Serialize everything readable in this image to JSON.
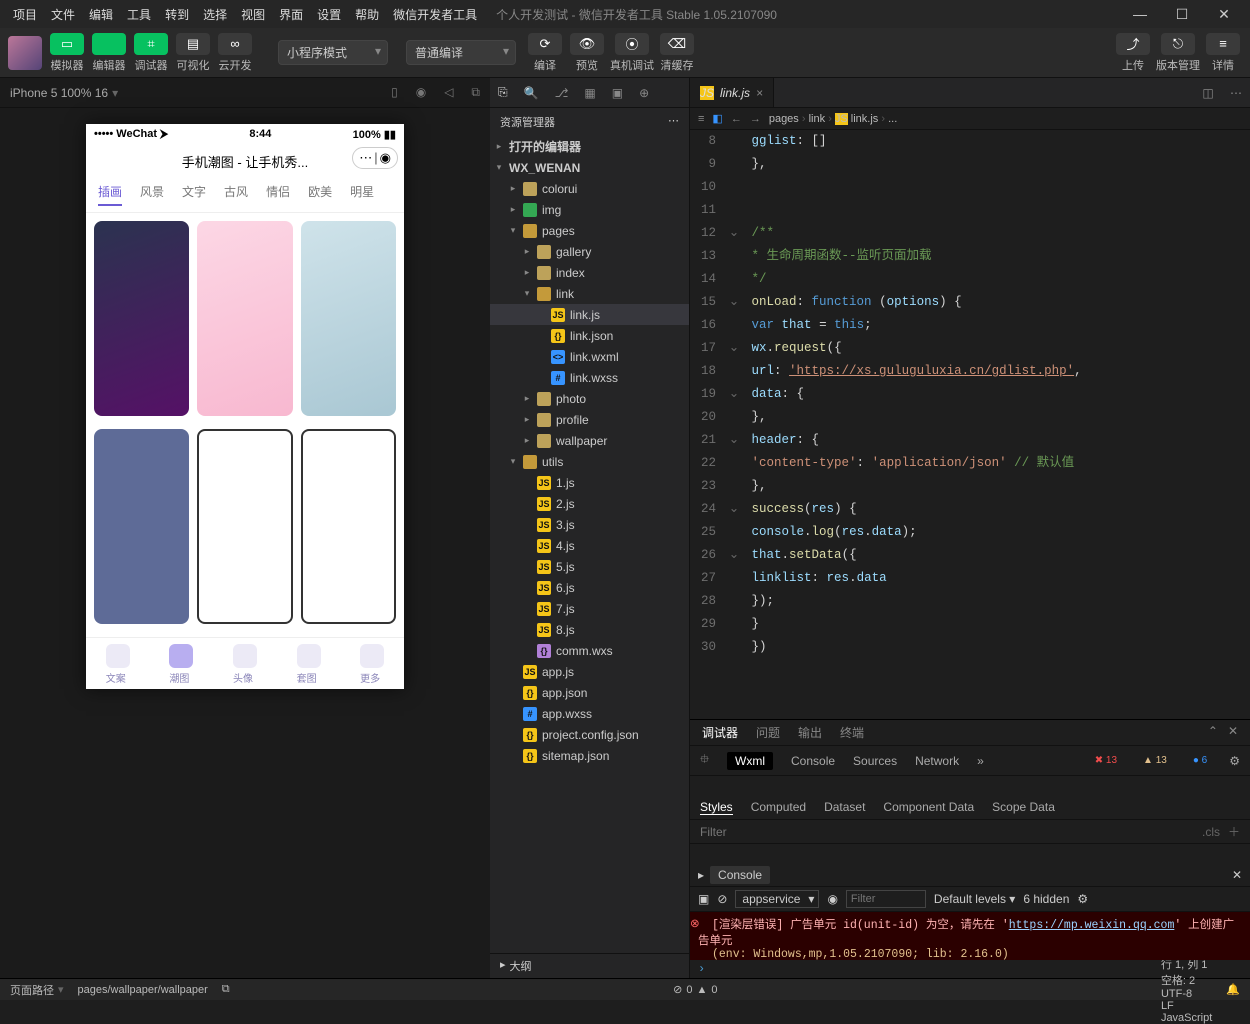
{
  "menu": {
    "items": [
      "项目",
      "文件",
      "编辑",
      "工具",
      "转到",
      "选择",
      "视图",
      "界面",
      "设置",
      "帮助",
      "微信开发者工具"
    ],
    "title": "个人开发测试 - 微信开发者工具 Stable 1.05.2107090"
  },
  "toolbar": {
    "modeButtons": [
      {
        "icon": "▭",
        "label": "模拟器",
        "cls": "green"
      },
      {
        "icon": "</>",
        "label": "编辑器",
        "cls": "green"
      },
      {
        "icon": "⌗",
        "label": "调试器",
        "cls": "green"
      },
      {
        "icon": "▤",
        "label": "可视化",
        "cls": "grey"
      },
      {
        "icon": "∞",
        "label": "云开发",
        "cls": "grey"
      }
    ],
    "compileMode": "小程序模式",
    "compileType": "普通编译",
    "centerButtons": [
      {
        "icon": "⟳",
        "label": "编译"
      },
      {
        "icon": "👁",
        "label": "预览"
      },
      {
        "icon": "⦿",
        "label": "真机调试"
      },
      {
        "icon": "⌫",
        "label": "清缓存"
      }
    ],
    "rightButtons": [
      {
        "icon": "⤴",
        "label": "上传"
      },
      {
        "icon": "⎋",
        "label": "版本管理"
      },
      {
        "icon": "≡",
        "label": "详情"
      }
    ]
  },
  "simulator": {
    "device": "iPhone 5 100% 16",
    "status": {
      "left": "••••• WeChat ⮞",
      "time": "8:44",
      "right": "100%"
    },
    "appTitle": "手机潮图 - 让手机秀...",
    "tabs": [
      "插画",
      "风景",
      "文字",
      "古风",
      "情侣",
      "欧美",
      "明星"
    ],
    "tabbar": [
      {
        "l": "文案"
      },
      {
        "l": "潮图"
      },
      {
        "l": "头像"
      },
      {
        "l": "套图"
      },
      {
        "l": "更多"
      }
    ],
    "activeTabbar": 1
  },
  "explorer": {
    "title": "资源管理器",
    "sections": [
      {
        "label": "打开的编辑器",
        "open": false
      },
      {
        "label": "WX_WENAN",
        "open": true
      }
    ],
    "tree": [
      {
        "d": 1,
        "t": "folder",
        "open": false,
        "n": "colorui"
      },
      {
        "d": 1,
        "t": "app",
        "open": false,
        "n": "img"
      },
      {
        "d": 1,
        "t": "folder-open",
        "open": true,
        "n": "pages"
      },
      {
        "d": 2,
        "t": "folder",
        "open": false,
        "n": "gallery"
      },
      {
        "d": 2,
        "t": "folder",
        "open": false,
        "n": "index"
      },
      {
        "d": 2,
        "t": "folder-open",
        "open": true,
        "n": "link"
      },
      {
        "d": 3,
        "t": "js",
        "n": "link.js",
        "sel": true
      },
      {
        "d": 3,
        "t": "json",
        "n": "link.json"
      },
      {
        "d": 3,
        "t": "wxml",
        "n": "link.wxml"
      },
      {
        "d": 3,
        "t": "wxss",
        "n": "link.wxss"
      },
      {
        "d": 2,
        "t": "folder",
        "open": false,
        "n": "photo"
      },
      {
        "d": 2,
        "t": "folder",
        "open": false,
        "n": "profile"
      },
      {
        "d": 2,
        "t": "folder",
        "open": false,
        "n": "wallpaper"
      },
      {
        "d": 1,
        "t": "folder-open",
        "open": true,
        "n": "utils"
      },
      {
        "d": 2,
        "t": "js",
        "n": "1.js"
      },
      {
        "d": 2,
        "t": "js",
        "n": "2.js"
      },
      {
        "d": 2,
        "t": "js",
        "n": "3.js"
      },
      {
        "d": 2,
        "t": "js",
        "n": "4.js"
      },
      {
        "d": 2,
        "t": "js",
        "n": "5.js"
      },
      {
        "d": 2,
        "t": "js",
        "n": "6.js"
      },
      {
        "d": 2,
        "t": "js",
        "n": "7.js"
      },
      {
        "d": 2,
        "t": "js",
        "n": "8.js"
      },
      {
        "d": 2,
        "t": "wxs",
        "n": "comm.wxs"
      },
      {
        "d": 1,
        "t": "js",
        "n": "app.js"
      },
      {
        "d": 1,
        "t": "json",
        "n": "app.json"
      },
      {
        "d": 1,
        "t": "wxss",
        "n": "app.wxss"
      },
      {
        "d": 1,
        "t": "json",
        "n": "project.config.json"
      },
      {
        "d": 1,
        "t": "json",
        "n": "sitemap.json"
      }
    ],
    "outline": "大纲"
  },
  "editor": {
    "tab": "link.js",
    "crumbs": [
      "pages",
      "link",
      "link.js",
      "..."
    ],
    "codeLines": [
      {
        "n": 8,
        "h": "      <span class='c-vr'>gglist</span><span class='c-pn'>: []</span>"
      },
      {
        "n": 9,
        "h": "    <span class='c-pn'>},</span>"
      },
      {
        "n": 10,
        "h": ""
      },
      {
        "n": 11,
        "h": ""
      },
      {
        "n": 12,
        "fold": "⌄",
        "h": "    <span class='c-cm'>/**</span>"
      },
      {
        "n": 13,
        "h": "    <span class='c-cm'> * 生命周期函数--监听页面加载</span>"
      },
      {
        "n": 14,
        "h": "    <span class='c-cm'> */</span>"
      },
      {
        "n": 15,
        "fold": "⌄",
        "h": "    <span class='c-fn'>onLoad</span><span class='c-pn'>: </span><span class='c-kw'>function</span> <span class='c-pn'>(</span><span class='c-vr'>options</span><span class='c-pn'>) {</span>"
      },
      {
        "n": 16,
        "h": "      <span class='c-kw'>var</span> <span class='c-vr'>that</span> <span class='c-pn'>=</span> <span class='c-kw'>this</span><span class='c-pn'>;</span>"
      },
      {
        "n": 17,
        "fold": "⌄",
        "h": "      <span class='c-vr'>wx</span><span class='c-pn'>.</span><span class='c-fn'>request</span><span class='c-pn'>({</span>"
      },
      {
        "n": 18,
        "h": "        <span class='c-vr'>url</span><span class='c-pn'>: </span><span class='c-url'>'https://xs.guluguluxia.cn/gdlist.php'</span><span class='c-pn'>,</span>"
      },
      {
        "n": 19,
        "fold": "⌄",
        "h": "        <span class='c-vr'>data</span><span class='c-pn'>: {</span>"
      },
      {
        "n": 20,
        "h": "        <span class='c-pn'>},</span>"
      },
      {
        "n": 21,
        "fold": "⌄",
        "h": "        <span class='c-vr'>header</span><span class='c-pn'>: {</span>"
      },
      {
        "n": 22,
        "h": "          <span class='c-str'>'content-type'</span><span class='c-pn'>: </span><span class='c-str'>'application/json'</span> <span class='c-cm'>// 默认值</span>"
      },
      {
        "n": 23,
        "h": "        <span class='c-pn'>},</span>"
      },
      {
        "n": 24,
        "fold": "⌄",
        "h": "        <span class='c-fn'>success</span><span class='c-pn'>(</span><span class='c-vr'>res</span><span class='c-pn'>) {</span>"
      },
      {
        "n": 25,
        "h": "          <span class='c-vr'>console</span><span class='c-pn'>.</span><span class='c-fn'>log</span><span class='c-pn'>(</span><span class='c-vr'>res</span><span class='c-pn'>.</span><span class='c-vr'>data</span><span class='c-pn'>);</span>"
      },
      {
        "n": 26,
        "fold": "⌄",
        "h": "          <span class='c-vr'>that</span><span class='c-pn'>.</span><span class='c-fn'>setData</span><span class='c-pn'>({</span>"
      },
      {
        "n": 27,
        "h": "            <span class='c-vr'>linklist</span><span class='c-pn'>: </span><span class='c-vr'>res</span><span class='c-pn'>.</span><span class='c-vr'>data</span>"
      },
      {
        "n": 28,
        "h": "          <span class='c-pn'>});</span>"
      },
      {
        "n": 29,
        "h": "        <span class='c-pn'>}</span>"
      },
      {
        "n": 30,
        "h": "      <span class='c-pn'>})</span>"
      }
    ]
  },
  "devtools": {
    "topTabs": [
      "调试器",
      "问题",
      "输出",
      "终端"
    ],
    "inspectorTabs": [
      "Wxml",
      "Console",
      "Sources",
      "Network"
    ],
    "badges": {
      "err": "13",
      "warn": "13",
      "info": "6"
    },
    "styleTabs": [
      "Styles",
      "Computed",
      "Dataset",
      "Component Data",
      "Scope Data"
    ],
    "filterPlaceholder": "Filter",
    "clsLabel": ".cls",
    "console": {
      "label": "Console",
      "context": "appservice",
      "filter": "Filter",
      "levels": "Default levels",
      "hidden": "6 hidden",
      "errLine": "[渲染层错误] 广告单元 id(unit-id) 为空，请先在 '",
      "errUrl": "https://mp.weixin.qq.com",
      "errTail": "' 上创建广告单元",
      "env": "(env: Windows,mp,1.05.2107090; lib: 2.16.0)"
    }
  },
  "statusbar": {
    "leftLabel": "页面路径",
    "path": "pages/wallpaper/wallpaper",
    "prohibit": "0",
    "warn": "0",
    "right": [
      "行 1, 列 1",
      "空格: 2",
      "UTF-8",
      "LF",
      "JavaScript"
    ]
  }
}
